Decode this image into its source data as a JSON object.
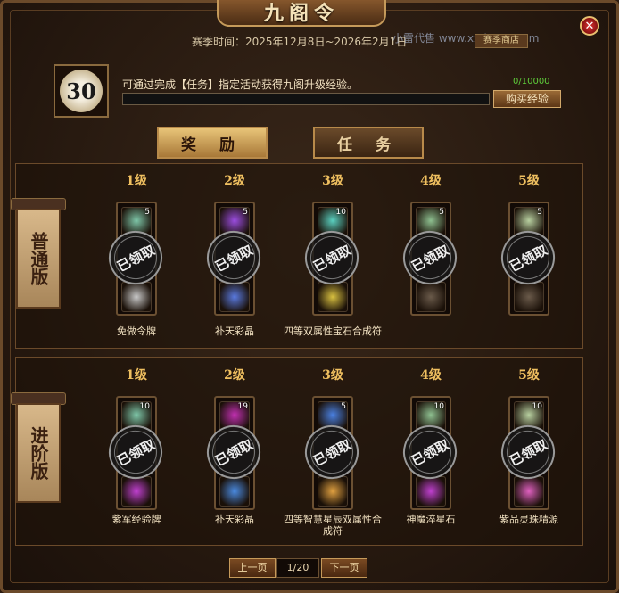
{
  "title": "九阁令",
  "season": "赛季时间：2025年12月8日~2026年2月1日",
  "watermark": "小雷代售 www.xxds777.com",
  "shop_tag": "赛季商店",
  "level": "30",
  "description": "可通过完成【任务】指定活动获得九阁升级经验。",
  "exp": {
    "text": "0/10000",
    "progress": 0
  },
  "buy_button": "购买经验",
  "tabs": {
    "reward": "奖 励",
    "task": "任 务"
  },
  "claimed_text": "已领取",
  "sections": [
    {
      "banner": "普通版",
      "tiers": [
        {
          "label": "1级",
          "top_count": "5",
          "name": "免做令牌",
          "top_color": "#7ec6a8",
          "bottom_color": "#c8c8c8"
        },
        {
          "label": "2级",
          "top_count": "5",
          "name": "补天彩晶",
          "top_color": "#9b4de0",
          "bottom_color": "#5a7ae0"
        },
        {
          "label": "3级",
          "top_count": "10",
          "name": "四等双属性宝石合成符",
          "top_color": "#5ad0c0",
          "bottom_color": "#d8c040"
        },
        {
          "label": "4级",
          "top_count": "5",
          "name": "",
          "top_color": "#8ec090",
          "bottom_color": "#6a5a4a"
        },
        {
          "label": "5级",
          "top_count": "5",
          "name": "",
          "top_color": "#b8d0a0",
          "bottom_color": "#6a5a4a"
        }
      ]
    },
    {
      "banner": "进阶版",
      "tiers": [
        {
          "label": "1级",
          "top_count": "10",
          "name": "紫军经验牌",
          "top_color": "#7ec6a8",
          "bottom_color": "#c040d0"
        },
        {
          "label": "2级",
          "top_count": "19",
          "name": "补天彩晶",
          "top_color": "#c030b0",
          "bottom_color": "#4a8ae0"
        },
        {
          "label": "3级",
          "top_count": "5",
          "name": "四等智慧星辰双属性合成符",
          "top_color": "#4a80e0",
          "bottom_color": "#e0a040"
        },
        {
          "label": "4级",
          "top_count": "10",
          "name": "神魔淬星石",
          "top_color": "#8ec090",
          "bottom_color": "#c040d0"
        },
        {
          "label": "5级",
          "top_count": "10",
          "name": "紫品灵珠精源",
          "top_color": "#b8d0a0",
          "bottom_color": "#e060c0"
        }
      ]
    }
  ],
  "pager": {
    "prev": "上一页",
    "page": "1/20",
    "next": "下一页"
  }
}
